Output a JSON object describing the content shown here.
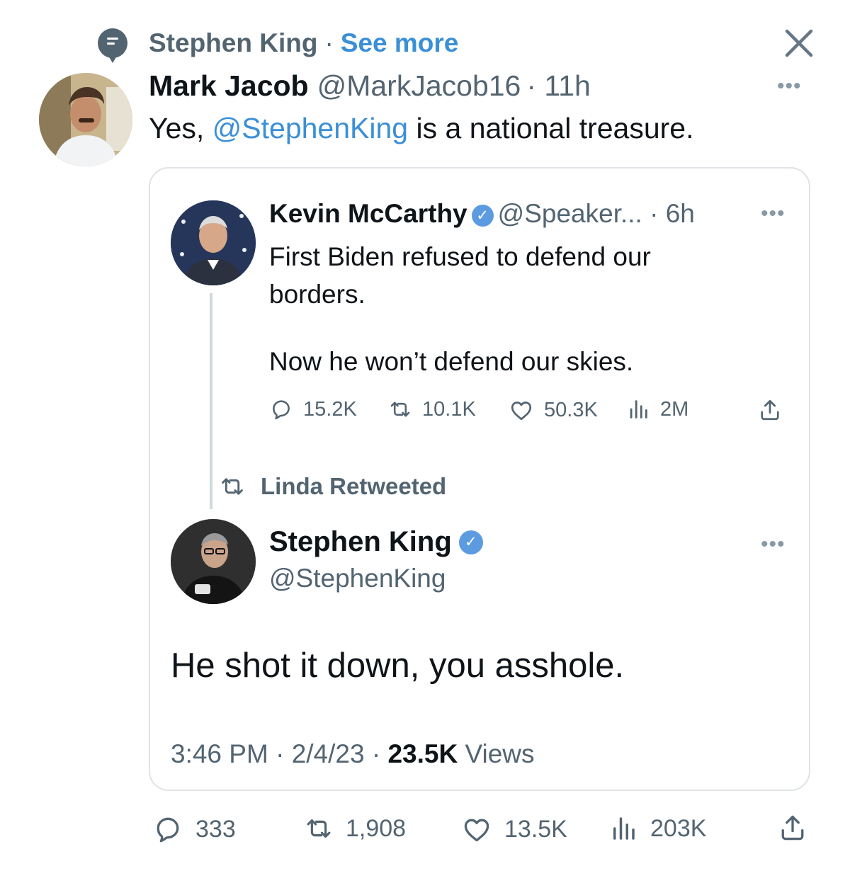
{
  "context": {
    "label": "Stephen King",
    "separator": "·",
    "link": "See more"
  },
  "tweet": {
    "author_name": "Mark Jacob",
    "author_handle": "@MarkJacob16",
    "time": "· 11h",
    "text_prefix": "Yes, ",
    "text_mention": "@StephenKing",
    "text_suffix": " is a national treasure.",
    "stats": {
      "replies": "333",
      "retweets": "1,908",
      "likes": "13.5K",
      "views": "203K"
    }
  },
  "quoted_thread": {
    "first": {
      "author_name": "Kevin McCarthy",
      "author_handle": "@Speaker...",
      "time": "· 6h",
      "text_line1": "First Biden refused to defend our borders.",
      "text_line2": "Now he won’t defend our skies.",
      "stats": {
        "replies": "15.2K",
        "retweets": "10.1K",
        "likes": "50.3K",
        "views": "2M"
      }
    },
    "retweet_label": "Linda Retweeted",
    "second": {
      "author_name": "Stephen King",
      "author_handle": "@StephenKing",
      "text": "He shot it down, you asshole.",
      "time": "3:46 PM",
      "date": "2/4/23",
      "views_count": "23.5K",
      "views_label": "Views"
    }
  },
  "colors": {
    "accent": "#3b8fd6",
    "muted": "#536471",
    "verified": "#5c9be0",
    "border": "#dfe3e6"
  },
  "icons": [
    "speech-bubble-icon",
    "close-icon",
    "more-icon",
    "verified-badge-icon",
    "reply-icon",
    "retweet-icon",
    "like-icon",
    "views-icon",
    "share-icon"
  ]
}
